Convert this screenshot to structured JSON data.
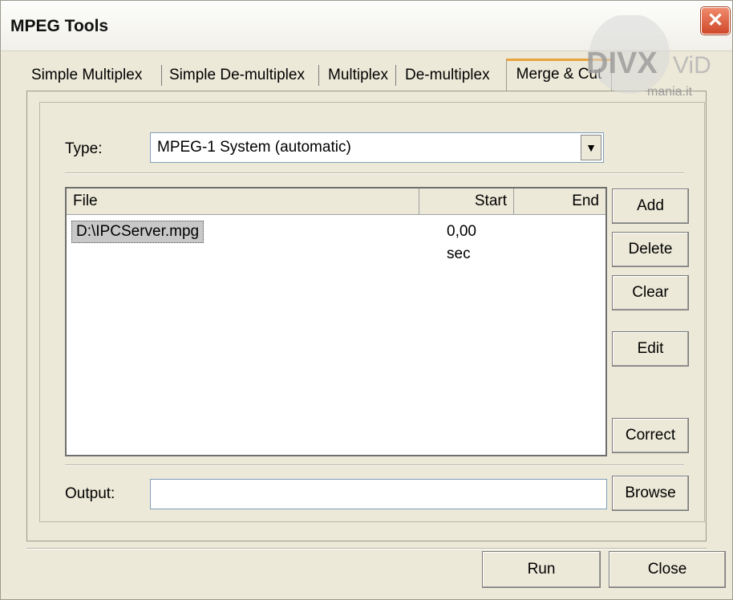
{
  "window": {
    "title": "MPEG Tools"
  },
  "tabs": [
    {
      "label": "Simple Multiplex"
    },
    {
      "label": "Simple De-multiplex"
    },
    {
      "label": "Multiplex"
    },
    {
      "label": "De-multiplex"
    },
    {
      "label": "Merge & Cut",
      "active": true
    }
  ],
  "form": {
    "type_label": "Type:",
    "type_value": "MPEG-1 System (automatic)",
    "output_label": "Output:",
    "output_value": ""
  },
  "list": {
    "columns": [
      "File",
      "Start",
      "End"
    ],
    "rows": [
      {
        "file": "D:\\IPCServer.mpg",
        "start": "0,00 sec",
        "end": ""
      }
    ]
  },
  "side_buttons": {
    "add": "Add",
    "delete": "Delete",
    "clear": "Clear",
    "edit": "Edit",
    "correct": "Correct",
    "browse": "Browse"
  },
  "footer": {
    "run": "Run",
    "close": "Close"
  },
  "watermark": {
    "brand": "DIVX VID",
    "site": "mania.it"
  },
  "colors": {
    "accent_tab": "#e8a33b",
    "close_red": "#d0482a"
  }
}
